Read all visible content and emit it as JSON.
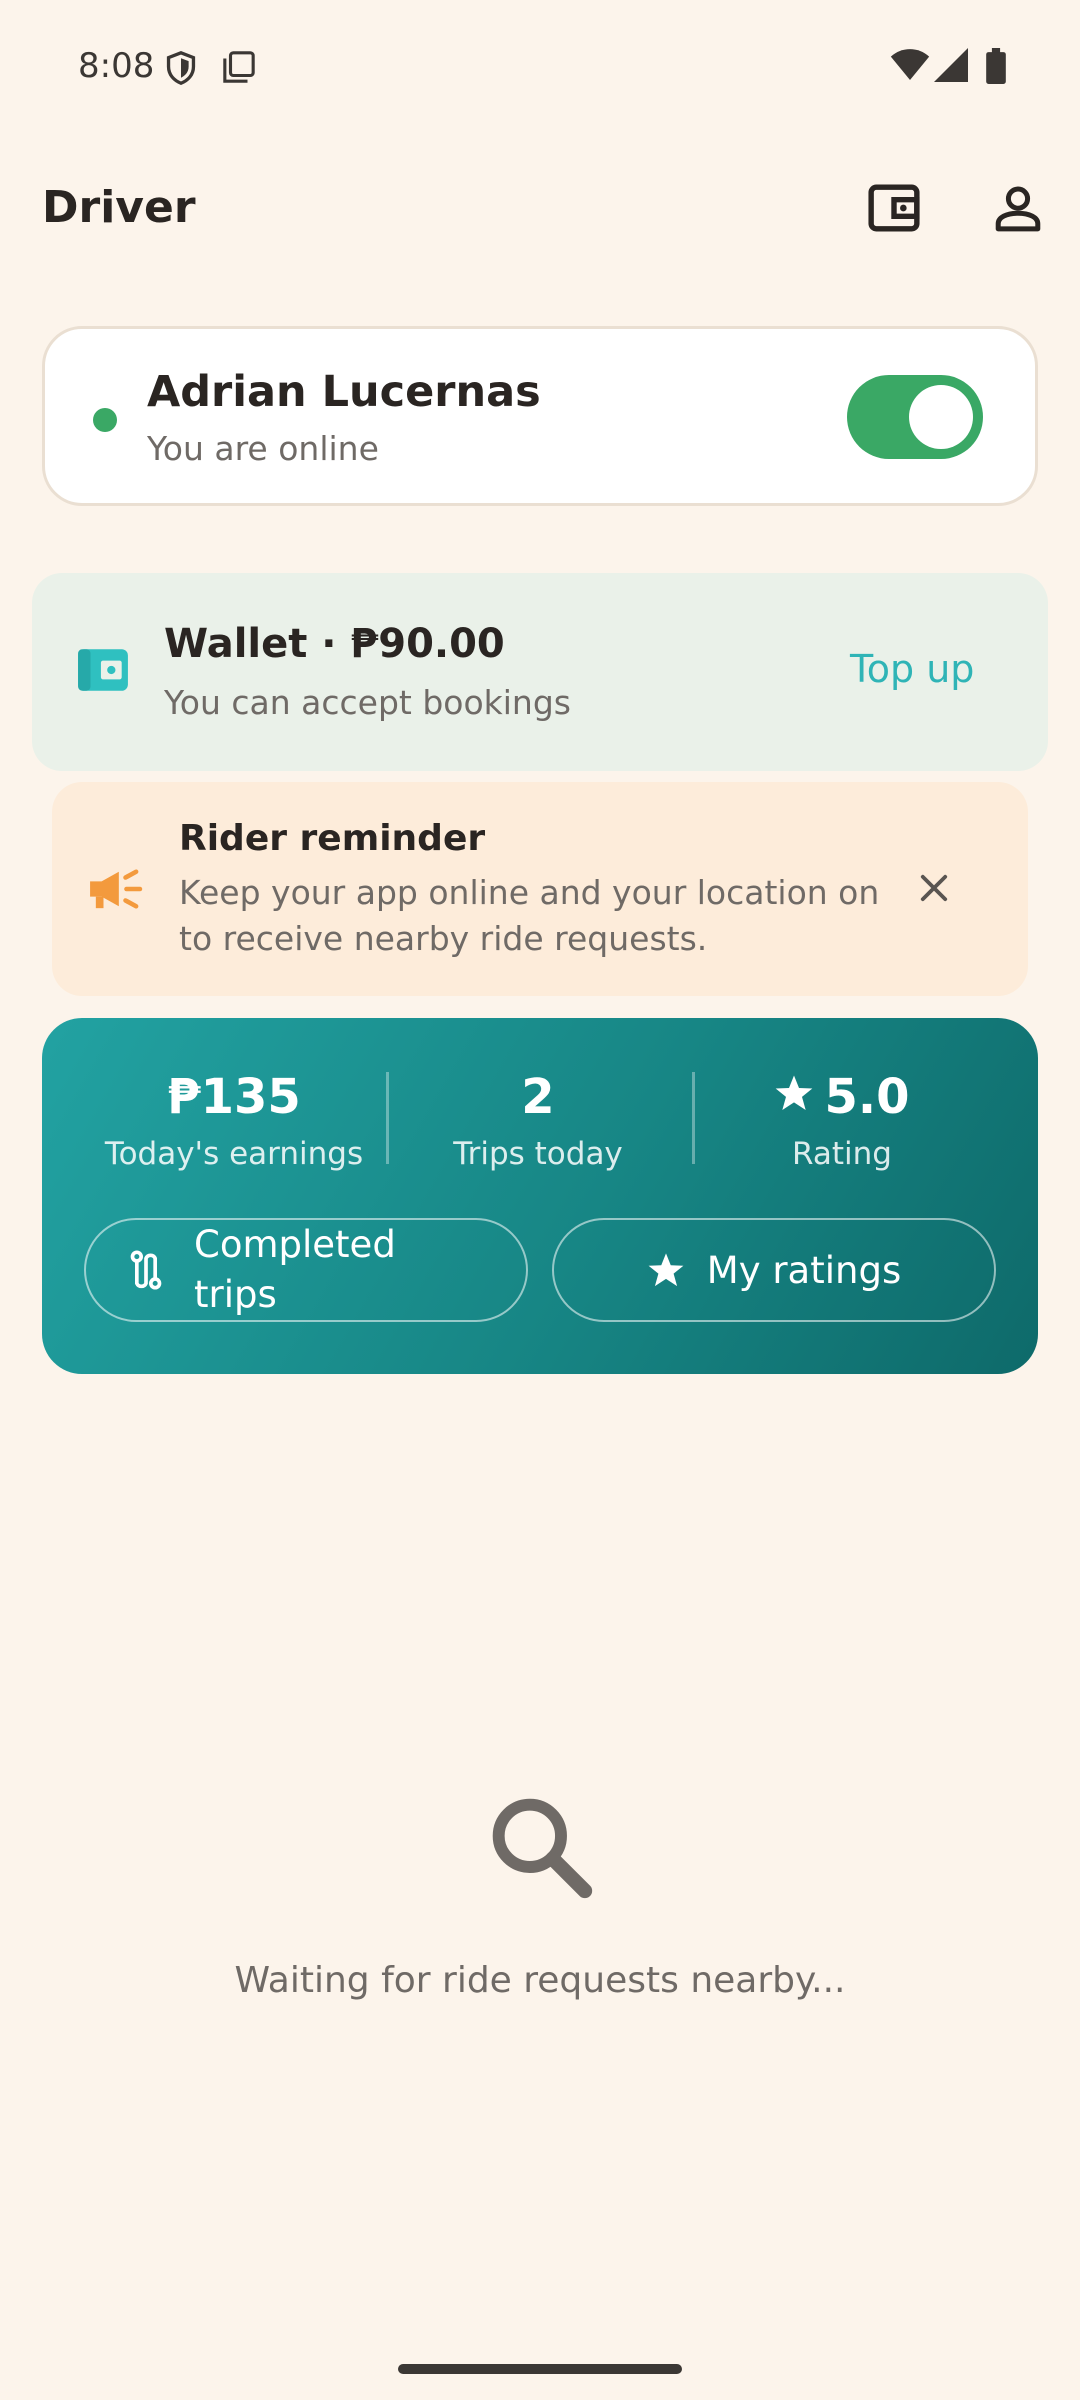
{
  "status_bar": {
    "time": "8:08",
    "left_icons": [
      "shield-icon",
      "screenshot-icon"
    ],
    "right_icons": [
      "wifi-icon",
      "cell-signal-icon",
      "battery-icon"
    ]
  },
  "app_bar": {
    "title": "Driver",
    "actions": [
      "wallet-icon",
      "profile-icon"
    ]
  },
  "driver": {
    "name": "Adrian Lucernas",
    "status": "You are online",
    "online": true
  },
  "wallet": {
    "title": "Wallet · ₱90.00",
    "subtitle": "You can accept bookings",
    "action": "Top up"
  },
  "reminder": {
    "title": "Rider reminder",
    "text": "Keep your app online and your location on to receive nearby ride requests."
  },
  "stats": {
    "earnings_value": "₱135",
    "earnings_label": "Today's earnings",
    "trips_value": "2",
    "trips_label": "Trips today",
    "rating_value": "5.0",
    "rating_label": "Rating",
    "completed_button": "Completed trips",
    "ratings_button": "My ratings"
  },
  "empty_state": {
    "text": "Waiting for ride requests nearby..."
  },
  "colors": {
    "background": "#fcf4eb",
    "accent_green": "#3aa865",
    "teal": "#178685",
    "topup": "#2fb4b6",
    "reminder_orange": "#f39a3d"
  }
}
